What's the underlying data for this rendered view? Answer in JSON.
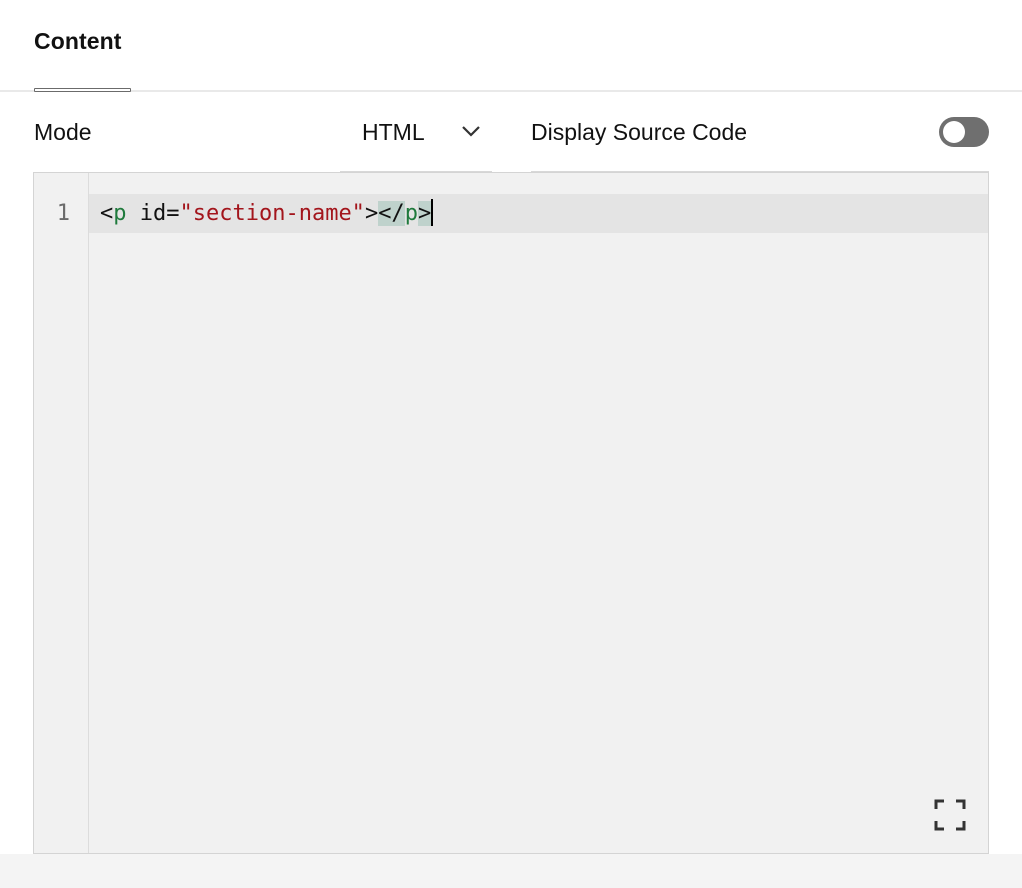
{
  "tabs": [
    {
      "label": "Content"
    }
  ],
  "settings": {
    "mode_label": "Mode",
    "mode_value": "HTML",
    "display_source_label": "Display Source Code",
    "display_source_enabled": false
  },
  "editor": {
    "line_number": "1",
    "tokens": {
      "open_bracket": "<",
      "tag_open": "p",
      "space": " ",
      "attr": "id",
      "eq": "=",
      "value": "\"section-name\"",
      "close_bracket": ">",
      "end_open": "</",
      "tag_close": "p",
      "end_close": ">"
    }
  },
  "colors": {
    "tag": "#1f7a3c",
    "string": "#a3151c",
    "toggle_off": "#6f6f6f",
    "editor_bg": "#f1f1f1"
  },
  "icons": {
    "chevron": "chevron-down-icon",
    "expand": "expand-icon"
  }
}
